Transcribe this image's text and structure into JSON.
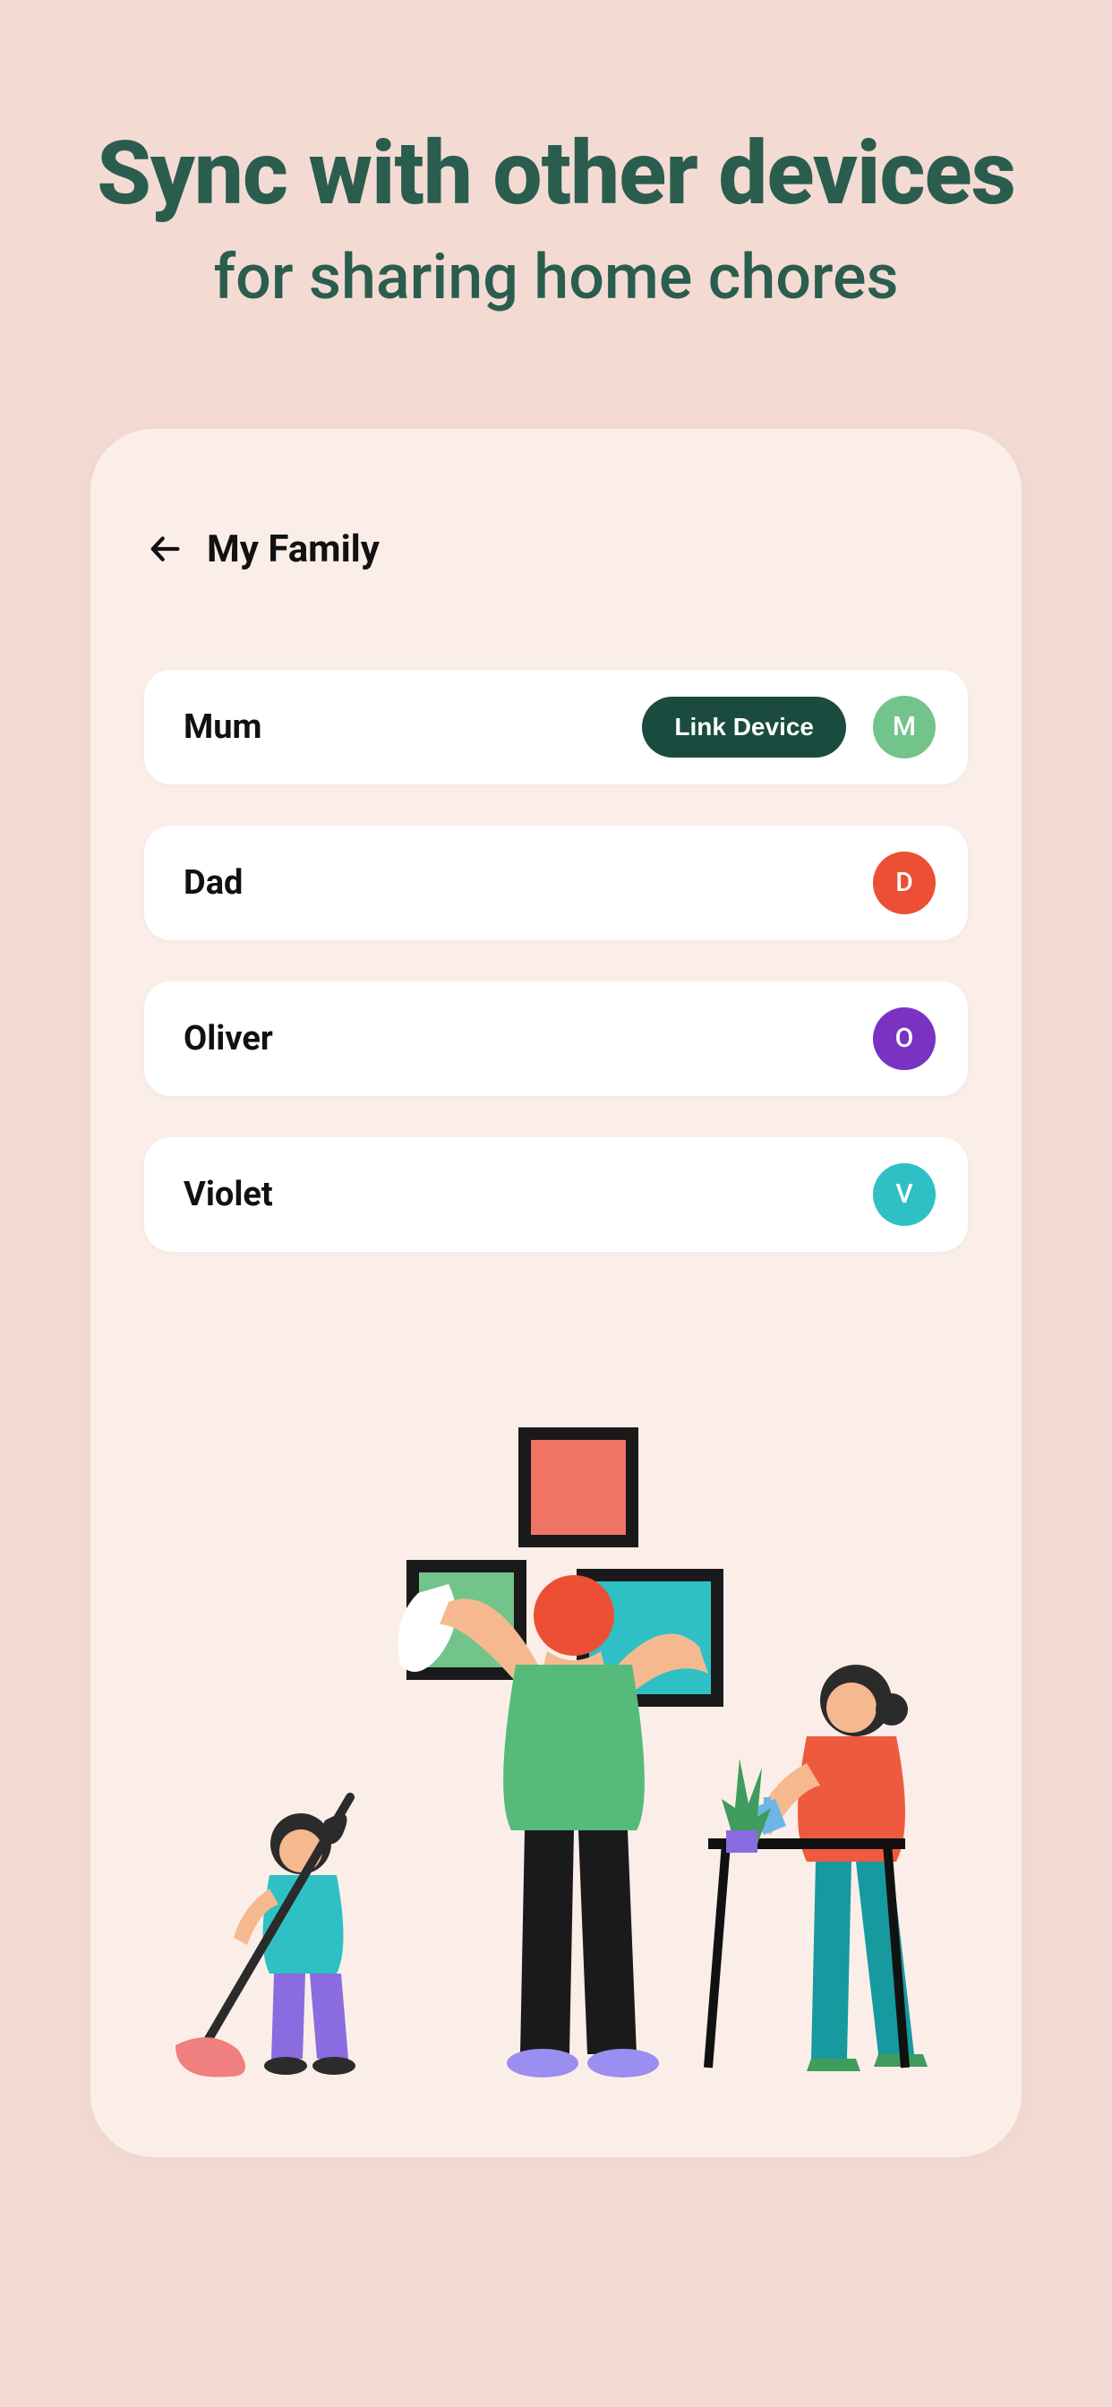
{
  "hero": {
    "title": "Sync with other devices",
    "subtitle": "for sharing home chores"
  },
  "card": {
    "title": "My Family",
    "link_button_label": "Link Device"
  },
  "members": [
    {
      "name": "Mum",
      "initial": "M",
      "avatar_color": "#73c48a",
      "show_link_button": true
    },
    {
      "name": "Dad",
      "initial": "D",
      "avatar_color": "#ec4f33",
      "show_link_button": false
    },
    {
      "name": "Oliver",
      "initial": "O",
      "avatar_color": "#7a32c3",
      "show_link_button": false
    },
    {
      "name": "Violet",
      "initial": "V",
      "avatar_color": "#2ec0c4",
      "show_link_button": false
    }
  ],
  "colors": {
    "page_bg": "#f3dbd3",
    "card_bg": "#fbeee8",
    "brand_text": "#2b5d4e",
    "btn_bg": "#1a4b3e"
  }
}
